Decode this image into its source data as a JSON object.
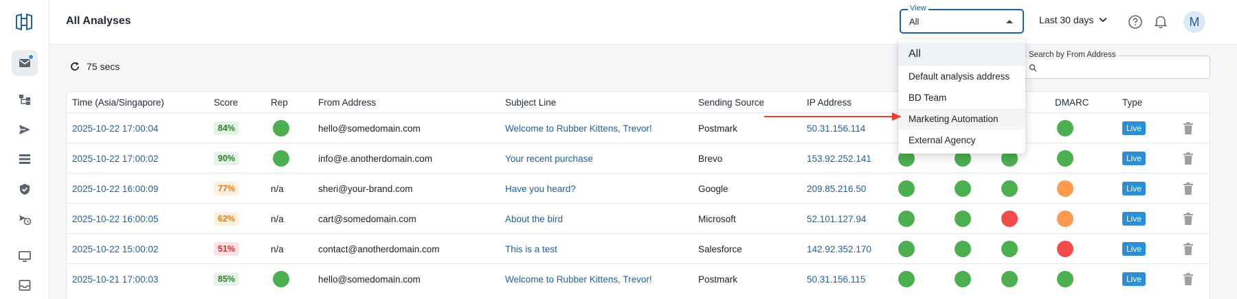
{
  "header": {
    "title": "All Analyses",
    "view_label": "View",
    "view_value": "All",
    "date_range": "Last 30 days",
    "avatar_initial": "M"
  },
  "toolbar": {
    "refresh_text": "75 secs",
    "search_label": "Search by From Address"
  },
  "view_menu": {
    "options": [
      "All",
      "Default analysis address",
      "BD Team",
      "Marketing Automation",
      "External Agency"
    ],
    "selected": "All",
    "highlighted": "Marketing Automation"
  },
  "table": {
    "columns": [
      "Time (Asia/Singapore)",
      "Score",
      "Rep",
      "From Address",
      "Subject Line",
      "Sending Source",
      "IP Address",
      "DMARC",
      "Type"
    ],
    "rows": [
      {
        "time": "2025-10-22 17:00:04",
        "score": "84%",
        "score_level": "good",
        "rep": "green",
        "from": "hello@somedomain.com",
        "subject": "Welcome to Rubber Kittens, Trevor!",
        "source": "Postmark",
        "ip": "50.31.156.114",
        "checks": [
          "green",
          "green",
          "green"
        ],
        "dmarc": "green",
        "type": "Live"
      },
      {
        "time": "2025-10-22 17:00:02",
        "score": "90%",
        "score_level": "good",
        "rep": "green",
        "from": "info@e.anotherdomain.com",
        "subject": "Your recent purchase",
        "source": "Brevo",
        "ip": "153.92.252.141",
        "checks": [
          "green",
          "green",
          "green"
        ],
        "dmarc": "green",
        "type": "Live"
      },
      {
        "time": "2025-10-22 16:00:09",
        "score": "77%",
        "score_level": "warn",
        "rep": "n/a",
        "from": "sheri@your-brand.com",
        "subject": "Have you heard?",
        "source": "Google",
        "ip": "209.85.216.50",
        "checks": [
          "green",
          "green",
          "green"
        ],
        "dmarc": "orange",
        "type": "Live"
      },
      {
        "time": "2025-10-22 16:00:05",
        "score": "62%",
        "score_level": "warn",
        "rep": "n/a",
        "from": "cart@somedomain.com",
        "subject": "About the bird",
        "source": "Microsoft",
        "ip": "52.101.127.94",
        "checks": [
          "green",
          "green",
          "red"
        ],
        "dmarc": "orange",
        "type": "Live"
      },
      {
        "time": "2025-10-22 15:00:02",
        "score": "51%",
        "score_level": "bad",
        "rep": "n/a",
        "from": "contact@anotherdomain.com",
        "subject": "This is a test",
        "source": "Salesforce",
        "ip": "142.92.352.170",
        "checks": [
          "green",
          "green",
          "green"
        ],
        "dmarc": "red",
        "type": "Live"
      },
      {
        "time": "2025-10-21 17:00:03",
        "score": "85%",
        "score_level": "good",
        "rep": "green",
        "from": "hello@somedomain.com",
        "subject": "Welcome to Rubber Kittens, Trevor!",
        "source": "Postmark",
        "ip": "50.31.156.115",
        "checks": [
          "green",
          "green",
          "green"
        ],
        "dmarc": "green",
        "type": "Live"
      }
    ]
  },
  "colors": {
    "accent": "#1e5fa8",
    "green": "#4caf50",
    "orange": "#ff9a4d",
    "red": "#f44b4b",
    "live": "#2a8fd6",
    "score_good_bg": "#e6f4e6",
    "score_good_fg": "#2e7d32",
    "score_warn_bg": "#fff0e0",
    "score_warn_fg": "#e07a1f",
    "score_bad_bg": "#fde4e4",
    "score_bad_fg": "#d32f2f",
    "annotation_arrow": "#e8412c"
  }
}
